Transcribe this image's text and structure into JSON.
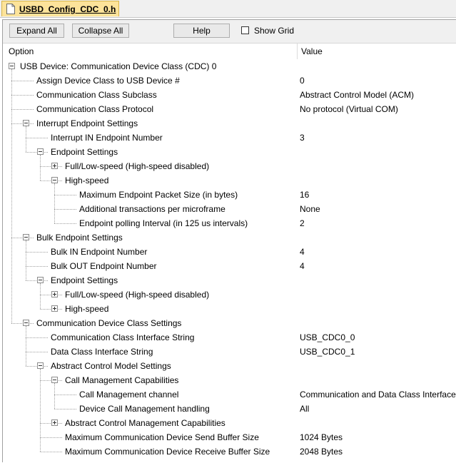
{
  "tab": {
    "title": "USBD_Config_CDC_0.h"
  },
  "toolbar": {
    "expand_all": "Expand All",
    "collapse_all": "Collapse All",
    "help": "Help",
    "show_grid": "Show Grid"
  },
  "columns": {
    "option": "Option",
    "value": "Value"
  },
  "tree": [
    {
      "label": "USB Device: Communication Device Class (CDC) 0",
      "value": "",
      "level": 0,
      "expander": "minus"
    },
    {
      "label": "Assign Device Class to USB Device #",
      "value": "0",
      "level": 1,
      "expander": ""
    },
    {
      "label": "Communication Class Subclass",
      "value": "Abstract Control Model (ACM)",
      "level": 1,
      "expander": ""
    },
    {
      "label": "Communication Class Protocol",
      "value": "No protocol (Virtual COM)",
      "level": 1,
      "expander": ""
    },
    {
      "label": "Interrupt Endpoint Settings",
      "value": "",
      "level": 1,
      "expander": "minus"
    },
    {
      "label": "Interrupt IN Endpoint Number",
      "value": "3",
      "level": 2,
      "expander": ""
    },
    {
      "label": "Endpoint Settings",
      "value": "",
      "level": 2,
      "expander": "minus"
    },
    {
      "label": "Full/Low-speed (High-speed disabled)",
      "value": "",
      "level": 3,
      "expander": "plus"
    },
    {
      "label": "High-speed",
      "value": "",
      "level": 3,
      "expander": "minus"
    },
    {
      "label": "Maximum Endpoint Packet Size (in bytes)",
      "value": "16",
      "level": 4,
      "expander": ""
    },
    {
      "label": "Additional transactions per microframe",
      "value": "None",
      "level": 4,
      "expander": ""
    },
    {
      "label": "Endpoint polling Interval (in 125 us intervals)",
      "value": "2",
      "level": 4,
      "expander": ""
    },
    {
      "label": "Bulk Endpoint Settings",
      "value": "",
      "level": 1,
      "expander": "minus"
    },
    {
      "label": "Bulk IN Endpoint Number",
      "value": "4",
      "level": 2,
      "expander": ""
    },
    {
      "label": "Bulk OUT Endpoint Number",
      "value": "4",
      "level": 2,
      "expander": ""
    },
    {
      "label": "Endpoint Settings",
      "value": "",
      "level": 2,
      "expander": "minus"
    },
    {
      "label": "Full/Low-speed (High-speed disabled)",
      "value": "",
      "level": 3,
      "expander": "plus"
    },
    {
      "label": "High-speed",
      "value": "",
      "level": 3,
      "expander": "plus"
    },
    {
      "label": "Communication Device Class Settings",
      "value": "",
      "level": 1,
      "expander": "minus"
    },
    {
      "label": "Communication Class Interface String",
      "value": "USB_CDC0_0",
      "level": 2,
      "expander": ""
    },
    {
      "label": "Data Class Interface String",
      "value": "USB_CDC0_1",
      "level": 2,
      "expander": ""
    },
    {
      "label": "Abstract Control Model Settings",
      "value": "",
      "level": 2,
      "expander": "minus"
    },
    {
      "label": "Call Management Capabilities",
      "value": "",
      "level": 3,
      "expander": "minus"
    },
    {
      "label": "Call Management channel",
      "value": "Communication and Data Class Interface",
      "level": 4,
      "expander": ""
    },
    {
      "label": "Device Call Management handling",
      "value": "All",
      "level": 4,
      "expander": ""
    },
    {
      "label": "Abstract Control Management Capabilities",
      "value": "",
      "level": 3,
      "expander": "plus"
    },
    {
      "label": "Maximum Communication Device Send Buffer Size",
      "value": "1024 Bytes",
      "level": 3,
      "expander": ""
    },
    {
      "label": "Maximum Communication Device Receive Buffer Size",
      "value": "2048 Bytes",
      "level": 3,
      "expander": ""
    }
  ]
}
